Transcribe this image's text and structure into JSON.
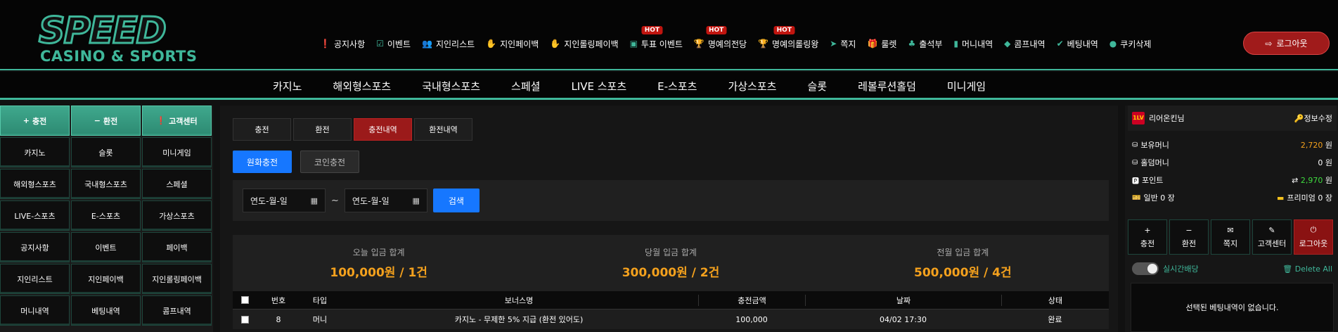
{
  "logo": {
    "main": "SPEED",
    "sub": "CASINO & SPORTS"
  },
  "topnav": [
    {
      "icon": "info-icon",
      "glyph": "❗",
      "label": "공지사항",
      "hot": ""
    },
    {
      "icon": "calendar-check-icon",
      "glyph": "☑",
      "label": "이벤트",
      "hot": ""
    },
    {
      "icon": "users-icon",
      "glyph": "👥",
      "label": "지인리스트",
      "hot": ""
    },
    {
      "icon": "hand-money-icon",
      "glyph": "✋",
      "label": "지인페이백",
      "hot": ""
    },
    {
      "icon": "hand-money-icon",
      "glyph": "✋",
      "label": "지인롤링페이백",
      "hot": ""
    },
    {
      "icon": "vote-icon",
      "glyph": "▣",
      "label": "투표 이벤트",
      "hot": "HOT"
    },
    {
      "icon": "trophy-icon",
      "glyph": "🏆",
      "label": "명예의전당",
      "hot": "HOT"
    },
    {
      "icon": "trophy-icon",
      "glyph": "🏆",
      "label": "명예의롤링왕",
      "hot": "HOT"
    },
    {
      "icon": "send-icon",
      "glyph": "➤",
      "label": "쪽지",
      "hot": ""
    },
    {
      "icon": "gift-icon",
      "glyph": "🎁",
      "label": "룰렛",
      "hot": ""
    },
    {
      "icon": "stamp-icon",
      "glyph": "♣",
      "label": "출석부",
      "hot": ""
    },
    {
      "icon": "wallet-icon",
      "glyph": "▮",
      "label": "머니내역",
      "hot": ""
    },
    {
      "icon": "piggy-bank-icon",
      "glyph": "◆",
      "label": "콤프내역",
      "hot": ""
    },
    {
      "icon": "check-icon",
      "glyph": "✔",
      "label": "베팅내역",
      "hot": ""
    },
    {
      "icon": "cookie-icon",
      "glyph": "●",
      "label": "쿠키삭제",
      "hot": ""
    }
  ],
  "logout_label": "로그아웃",
  "mainnav": [
    "카지노",
    "해외형스포츠",
    "국내형스포츠",
    "스페셜",
    "LIVE 스포츠",
    "E-스포츠",
    "가상스포츠",
    "슬롯",
    "레볼루션홀덤",
    "미니게임"
  ],
  "left_top": [
    {
      "glyph": "+",
      "label": "충전"
    },
    {
      "glyph": "−",
      "label": "환전"
    },
    {
      "glyph": "❗",
      "label": "고객센터"
    }
  ],
  "left_grid": [
    [
      "카지노",
      "슬롯",
      "미니게임"
    ],
    [
      "해외형스포츠",
      "국내형스포츠",
      "스페셜"
    ],
    [
      "LIVE-스포츠",
      "E-스포츠",
      "가상스포츠"
    ],
    [
      "공지사항",
      "이벤트",
      "페이백"
    ],
    [
      "지인리스트",
      "지인페이백",
      "지인롤링페이백"
    ],
    [
      "머니내역",
      "베팅내역",
      "콤프내역"
    ]
  ],
  "tabs": [
    "충전",
    "환전",
    "충전내역",
    "환전내역"
  ],
  "active_tab": 2,
  "subtabs": [
    "원화충전",
    "코인충전"
  ],
  "date_placeholder": "연도-월-일",
  "tilde": "~",
  "search_label": "검색",
  "summary": [
    {
      "label": "오늘 입금 합계",
      "value": "100,000원 / 1건"
    },
    {
      "label": "당월 입금 합계",
      "value": "300,000원 / 2건"
    },
    {
      "label": "전월 입금 합계",
      "value": "500,000원 / 4건"
    }
  ],
  "table": {
    "headers": [
      "번호",
      "타입",
      "보너스명",
      "충전금액",
      "날짜",
      "상태"
    ],
    "rows": [
      {
        "no": "8",
        "type": "머니",
        "bonus": "카지노 - 무제한 5% 지급 (환전 있어도)",
        "amount": "100,000",
        "date": "04/02 17:30",
        "status": "완료"
      }
    ]
  },
  "right": {
    "user_badge": "1LV",
    "user_name": "리어온킨님",
    "edit_label": "정보수정",
    "rows": [
      {
        "label": "보유머니",
        "value": "2,720",
        "unit": "원",
        "prefix": ""
      },
      {
        "label": "홀덤머니",
        "value": "0",
        "unit": "원",
        "prefix": ""
      },
      {
        "label": "포인트",
        "value": "2,970",
        "unit": "원",
        "prefix": "⇄"
      },
      {
        "label": "일반 0 장",
        "value": "프리미엄 0 장",
        "unit": "",
        "prefix": ""
      }
    ],
    "buttons": [
      {
        "glyph": "+",
        "label": "충전"
      },
      {
        "glyph": "−",
        "label": "환전"
      },
      {
        "glyph": "✉",
        "label": "쪽지"
      },
      {
        "glyph": "✎",
        "label": "고객센터"
      },
      {
        "glyph": "⏻",
        "label": "로그아웃"
      }
    ],
    "live_label": "실시간배당",
    "delete_all": "Delete All",
    "empty_msg": "선택된 베팅내역이 없습니다."
  }
}
